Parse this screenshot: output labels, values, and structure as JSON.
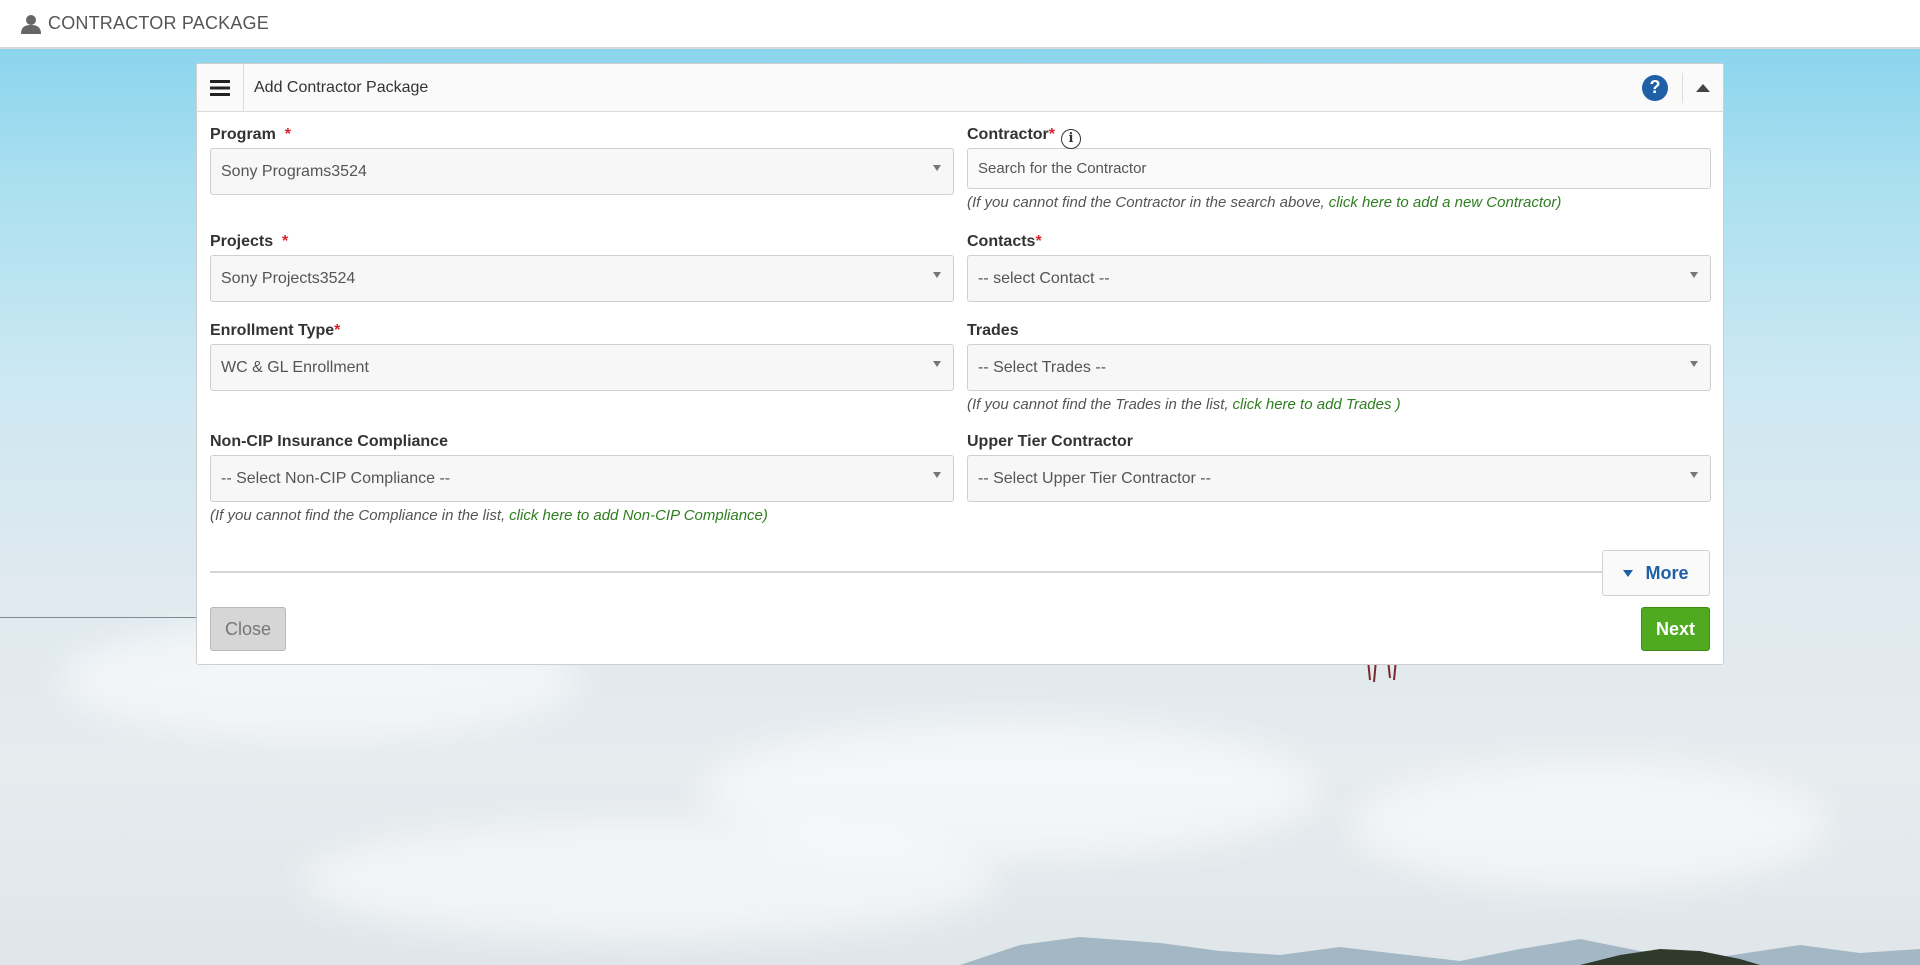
{
  "app": {
    "title": "CONTRACTOR PACKAGE"
  },
  "panel": {
    "title": "Add Contractor Package"
  },
  "colors": {
    "accent": "#1f5fa8",
    "link": "#2f7d20",
    "required": "#d9232d",
    "next": "#4faa1f"
  },
  "fields": {
    "program": {
      "label": "Program",
      "required_mark": "*",
      "value": "Sony Programs3524"
    },
    "contractor": {
      "label": "Contractor",
      "required_mark": "*",
      "info_glyph": "i",
      "placeholder": "Search for the Contractor",
      "hint_text": "(If you cannot find the Contractor in the search above,",
      "hint_link": "click here to add a new Contractor)"
    },
    "projects": {
      "label": "Projects",
      "required_mark": "*",
      "value": "Sony Projects3524"
    },
    "contacts": {
      "label": "Contacts",
      "required_mark": "*",
      "value": "-- select Contact --"
    },
    "enrollment_type": {
      "label": "Enrollment Type",
      "required_mark": "*",
      "value": "WC & GL Enrollment"
    },
    "trades": {
      "label": "Trades",
      "value": "-- Select Trades --",
      "hint_text": "(If you cannot find the Trades in the list,",
      "hint_link": "click here to add Trades )"
    },
    "non_cip": {
      "label": "Non-CIP Insurance Compliance",
      "value": "-- Select Non-CIP Compliance --",
      "hint_text": "(If you cannot find the Compliance in the list,",
      "hint_link": "click here to add Non-CIP Compliance)"
    },
    "upper_tier": {
      "label": "Upper Tier Contractor",
      "value": "-- Select Upper Tier Contractor --"
    }
  },
  "buttons": {
    "more": "More",
    "close": "Close",
    "next": "Next",
    "help": "?"
  },
  "icons": {
    "user": "user-icon",
    "menu": "hamburger-icon",
    "help": "help-icon",
    "collapse": "chevron-up-icon",
    "info": "info-icon",
    "dropdown": "caret-down-icon"
  }
}
